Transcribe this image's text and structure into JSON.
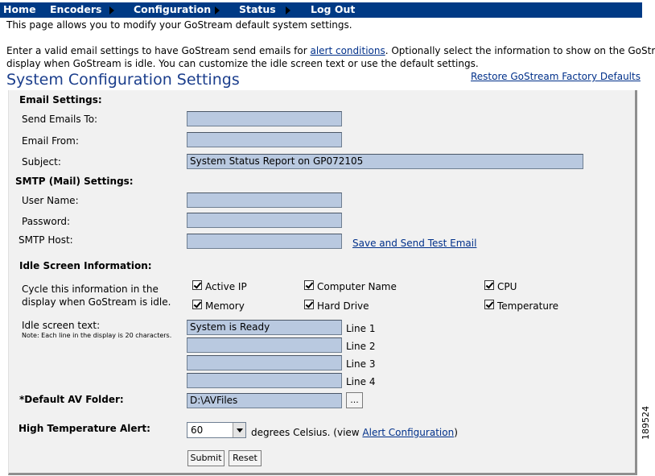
{
  "nav": {
    "items": [
      "Home",
      "Encoders",
      "Configuration",
      "Status",
      "Log Out"
    ]
  },
  "intro": {
    "line1": "This page allows you to modify your GoStream default system settings.",
    "line2_before": "Enter a valid email settings to have GoStream send emails for ",
    "line2_link": "alert conditions",
    "line2_after": ". Optionally select the information to show on the GoStream",
    "line3": "display when GoStream is idle. You can customize the idle screen text or use the default settings."
  },
  "page_title": "System Configuration Settings",
  "restore_link": "Restore GoStream Factory Defaults",
  "email": {
    "heading": "Email Settings:",
    "send_to_label": "Send Emails To:",
    "send_to_value": "",
    "from_label": "Email From:",
    "from_value": "",
    "subject_label": "Subject:",
    "subject_value": "System Status Report on GP072105"
  },
  "smtp": {
    "heading": "SMTP (Mail) Settings:",
    "username_label": "User Name:",
    "username_value": "",
    "password_label": "Password:",
    "password_value": "",
    "host_label": "SMTP Host:",
    "host_value": "",
    "test_link": "Save and Send Test Email"
  },
  "idle": {
    "heading": "Idle Screen Information:",
    "cycle_line1": "Cycle this information in the",
    "cycle_line2": "display when GoStream is idle.",
    "options": {
      "active_ip": "Active IP",
      "computer_name": "Computer Name",
      "cpu": "CPU",
      "memory": "Memory",
      "hard_drive": "Hard Drive",
      "temperature": "Temperature"
    },
    "text_label": "Idle screen text:",
    "note": "Note:  Each line in the display is 20 characters.",
    "lines": [
      {
        "value": "System is Ready",
        "label": "Line 1"
      },
      {
        "value": "",
        "label": "Line 2"
      },
      {
        "value": "",
        "label": "Line 3"
      },
      {
        "value": "",
        "label": "Line 4"
      }
    ]
  },
  "av_folder": {
    "label": "*Default AV Folder:",
    "value": "D:\\AVFiles",
    "browse_label": "..."
  },
  "temperature": {
    "label": "High Temperature Alert:",
    "value": "60",
    "units_text": "degrees Celsius.  (view ",
    "link": "Alert Configuration",
    "close_paren": ")"
  },
  "buttons": {
    "submit": "Submit",
    "reset": "Reset"
  },
  "side_code": "189524",
  "colors": {
    "nav_bg": "#003a85",
    "title": "#1b3e8c",
    "field_bg": "#b9c9e0"
  }
}
